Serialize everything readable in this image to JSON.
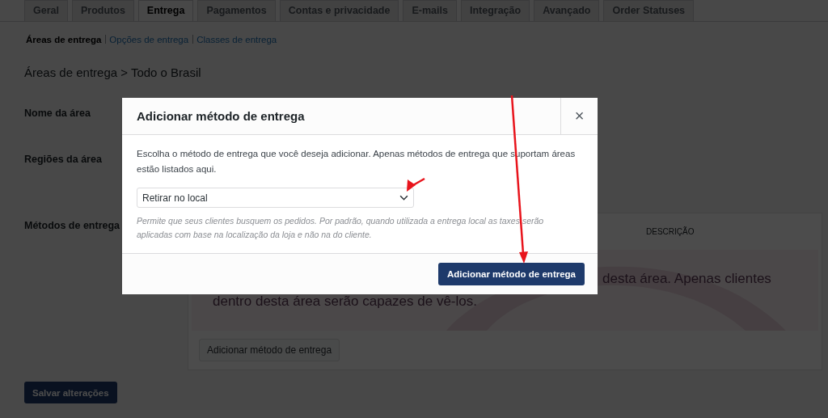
{
  "tabs": [
    {
      "label": "Geral",
      "selected": false
    },
    {
      "label": "Produtos",
      "selected": false
    },
    {
      "label": "Entrega",
      "selected": true
    },
    {
      "label": "Pagamentos",
      "selected": false
    },
    {
      "label": "Contas e privacidade",
      "selected": false
    },
    {
      "label": "E-mails",
      "selected": false
    },
    {
      "label": "Integração",
      "selected": false
    },
    {
      "label": "Avançado",
      "selected": false
    },
    {
      "label": "Order Statuses",
      "selected": false
    }
  ],
  "subnav": [
    {
      "label": "Áreas de entrega",
      "selected": true
    },
    {
      "label": "Opções de entrega",
      "selected": false
    },
    {
      "label": "Classes de entrega",
      "selected": false
    }
  ],
  "heading": "Áreas de entrega > Todo o Brasil",
  "fields": [
    {
      "label": "Nome da área"
    },
    {
      "label": "Regiões da área"
    }
  ],
  "methods": {
    "label": "Métodos de entrega",
    "columns": [
      "DESCRIÇÃO"
    ],
    "blank_state": [
      "desta área. Apenas clientes",
      "dentro desta área serão capazes de vê-los."
    ],
    "add_button": "Adicionar método de entrega"
  },
  "save_button": "Salvar alterações",
  "modal": {
    "title": "Adicionar método de entrega",
    "close": "×",
    "intro": "Escolha o método de entrega que você deseja adicionar. Apenas métodos de entrega que suportam áreas estão listados aqui.",
    "select": {
      "value": "Retirar no local"
    },
    "help": "Permite que seus clientes busquem os pedidos. Por padrão, quando utilizada a entrega local as taxes serão aplicadas com base na localização da loja e não na do cliente.",
    "submit": "Adicionar método de entrega"
  }
}
